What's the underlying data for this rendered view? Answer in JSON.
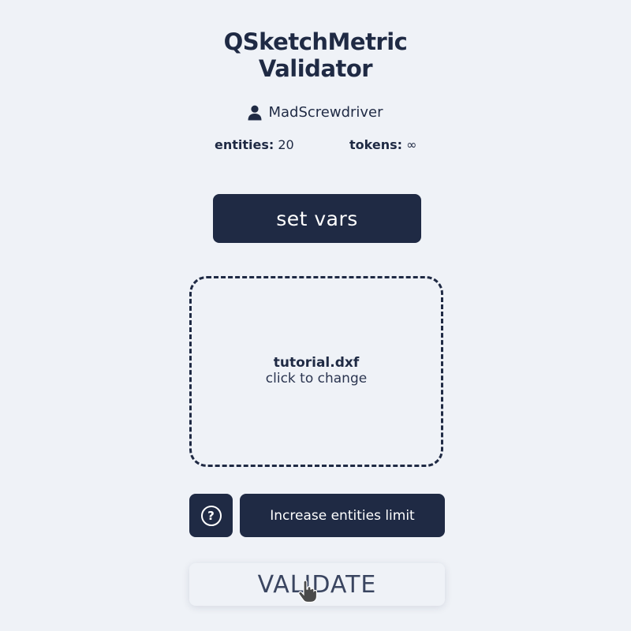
{
  "header": {
    "title_line1": "QSketchMetric",
    "title_line2": "Validator"
  },
  "user": {
    "icon": "user-icon",
    "name": "MadScrewdriver"
  },
  "stats": {
    "entities_label": "entities:",
    "entities_value": "20",
    "tokens_label": "tokens:",
    "tokens_value": "∞"
  },
  "actions": {
    "set_vars_label": "set vars",
    "increase_limit_label": "Increase entities limit",
    "help_icon": "question-circle-icon",
    "help_glyph": "?",
    "validate_label": "VALIDATE"
  },
  "upload": {
    "file_name": "tutorial.dxf",
    "hint": "click to change"
  },
  "colors": {
    "primary": "#1f2a44",
    "background": "#eff2f7",
    "button_text": "#ffffff"
  }
}
